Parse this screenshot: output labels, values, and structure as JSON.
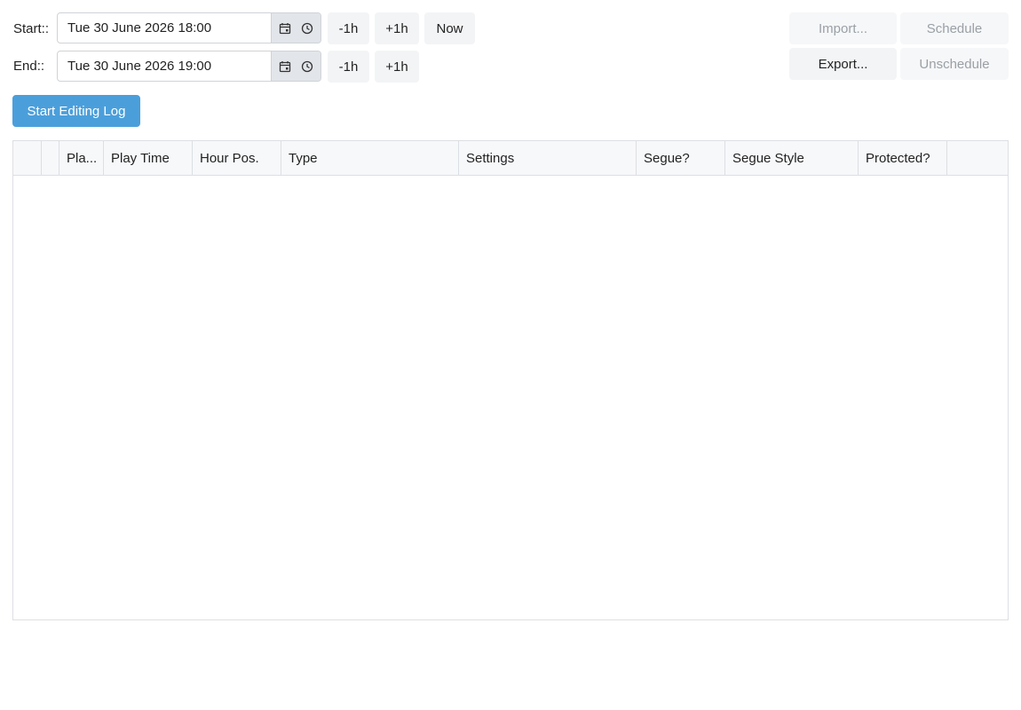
{
  "start": {
    "label": "Start::",
    "value": "Tue 30 June 2026 18:00",
    "minus_label": "-1h",
    "plus_label": "+1h",
    "now_label": "Now"
  },
  "end": {
    "label": "End::",
    "value": "Tue 30 June 2026 19:00",
    "minus_label": "-1h",
    "plus_label": "+1h"
  },
  "actions": {
    "import_label": "Import...",
    "schedule_label": "Schedule",
    "export_label": "Export...",
    "unschedule_label": "Unschedule",
    "edit_log_label": "Start Editing Log"
  },
  "table": {
    "columns": [
      "",
      "",
      "Pla...",
      "Play Time",
      "Hour Pos.",
      "Type",
      "Settings",
      "Segue?",
      "Segue Style",
      "Protected?",
      ""
    ],
    "rows": []
  },
  "colors": {
    "primary": "#4a9fdb",
    "button_bg": "#f3f4f6",
    "disabled_text": "#9aa0a6",
    "border": "#dcdfe3"
  },
  "icons": {
    "calendar": "calendar-icon",
    "clock": "clock-icon"
  }
}
